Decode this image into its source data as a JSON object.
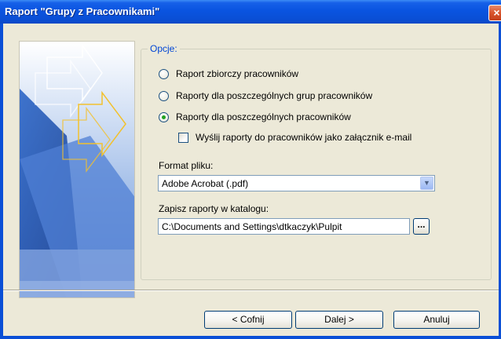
{
  "window": {
    "title": "Raport \"Grupy z Pracownikami\"",
    "close_glyph": "×"
  },
  "options": {
    "group_title": "Opcje:",
    "radios": [
      {
        "label": "Raport zbiorczy pracowników",
        "checked": false
      },
      {
        "label": "Raporty dla poszczególnych grup pracowników",
        "checked": false
      },
      {
        "label": "Raporty dla poszczególnych pracowników",
        "checked": true
      }
    ],
    "email_checkbox": {
      "label": "Wyślij raporty do pracowników jako załącznik e-mail",
      "checked": false
    },
    "format_label": "Format pliku:",
    "format_value": "Adobe Acrobat (.pdf)",
    "directory_label": "Zapisz raporty w katalogu:",
    "directory_value": "C:\\Documents and Settings\\dtkaczyk\\Pulpit",
    "browse_label": "..."
  },
  "buttons": {
    "back": "< Cofnij",
    "next": "Dalej >",
    "cancel": "Anuluj"
  }
}
